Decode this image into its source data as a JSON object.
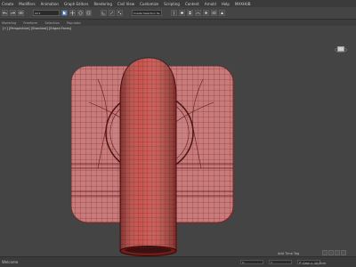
{
  "menu": {
    "items": [
      "Create",
      "Modifiers",
      "Animation",
      "Graph Editors",
      "Rendering",
      "Civil View",
      "Customize",
      "Scripting",
      "Content",
      "Arnold",
      "Help",
      "MAXHUB"
    ]
  },
  "toolbar": {
    "selection_set_placeholder": "Create Selection Se"
  },
  "ribbon": {
    "tabs": [
      "Modeling",
      "Freeform",
      "Selection",
      "Populate"
    ]
  },
  "viewport": {
    "label": "[+] [Perspective] [Standard] [Edged Faces]"
  },
  "status": {
    "left_text": "Welcome",
    "x_label": "X: ",
    "y_label": "Y: ",
    "z_label": "Z: ",
    "grid_text": "Grid = 10,0cm",
    "add_time_tag": "Add Time Tag"
  },
  "colors": {
    "background": "#444444",
    "mesh_fill": "#c97b7b",
    "mesh_wire": "#5a1a1a",
    "cylinder_fill": "#c44a44",
    "cylinder_dark": "#6d1f1c"
  },
  "icons": [
    "undo-icon",
    "redo-icon",
    "link-icon",
    "select-icon",
    "move-icon",
    "rotate-icon",
    "scale-icon",
    "snap-icon",
    "render-icon",
    "viewcube-icon"
  ]
}
